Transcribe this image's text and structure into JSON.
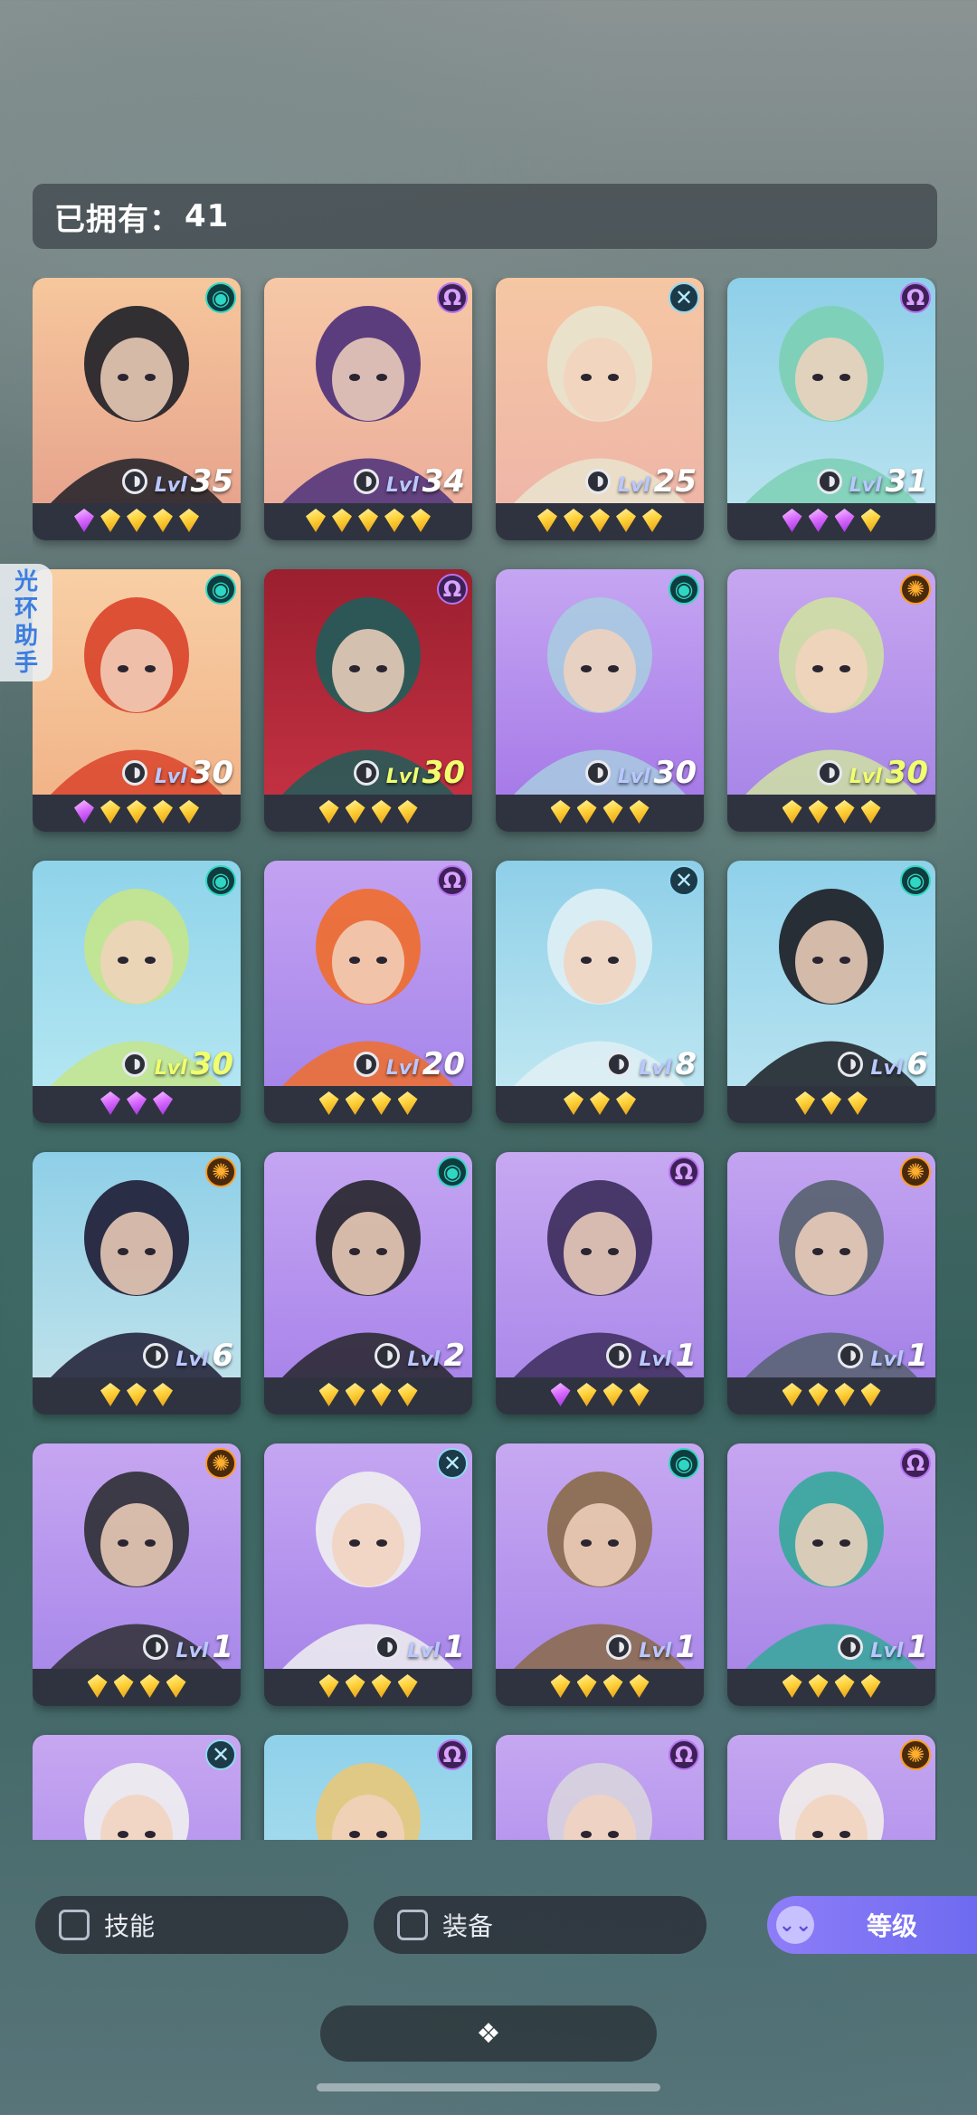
{
  "owned": {
    "label": "已拥有：",
    "count": "41"
  },
  "side_tab": {
    "chars": [
      "光",
      "环",
      "助",
      "手"
    ]
  },
  "level_label": "Lvl",
  "cards": [
    {
      "element": "teal",
      "level": "35",
      "stars": [
        "p",
        "g",
        "g",
        "g",
        "g"
      ],
      "bg": [
        "#f6c79c",
        "#e7a48d"
      ]
    },
    {
      "element": "purple",
      "level": "34",
      "stars": [
        "g",
        "g",
        "g",
        "g",
        "g"
      ],
      "bg": [
        "#f6c8a6",
        "#ecae9b"
      ]
    },
    {
      "element": "cross",
      "level": "25",
      "stars": [
        "g",
        "g",
        "g",
        "g",
        "g"
      ],
      "bg": [
        "#f5c7a3",
        "#efb6a8"
      ]
    },
    {
      "element": "purple",
      "level": "31",
      "stars": [
        "p",
        "p",
        "p",
        "g"
      ],
      "bg": [
        "#8ecfe8",
        "#b7e2ef"
      ]
    },
    {
      "element": "teal",
      "level": "30",
      "stars": [
        "p",
        "g",
        "g",
        "g",
        "g"
      ],
      "bg": [
        "#f8cfa5",
        "#f2b489"
      ]
    },
    {
      "element": "purple",
      "level": "30",
      "stars": [
        "g",
        "g",
        "g",
        "g"
      ],
      "bg": [
        "#9a1f2f",
        "#c23142"
      ],
      "high": true
    },
    {
      "element": "teal",
      "level": "30",
      "stars": [
        "g",
        "g",
        "g",
        "g"
      ],
      "bg": [
        "#c5a6f2",
        "#a77be8"
      ]
    },
    {
      "element": "orange",
      "level": "30",
      "stars": [
        "g",
        "g",
        "g",
        "g"
      ],
      "bg": [
        "#c7a6f0",
        "#a887e8"
      ],
      "high": true
    },
    {
      "element": "teal",
      "level": "30",
      "stars": [
        "p",
        "p",
        "p"
      ],
      "bg": [
        "#8fd3ea",
        "#b3e6f2"
      ],
      "high": true
    },
    {
      "element": "purple",
      "level": "20",
      "stars": [
        "g",
        "g",
        "g",
        "g"
      ],
      "bg": [
        "#c3a2f2",
        "#a686ea"
      ]
    },
    {
      "element": "cross",
      "level": "8",
      "stars": [
        "g",
        "g",
        "g"
      ],
      "bg": [
        "#8ecfe8",
        "#bde6f1"
      ]
    },
    {
      "element": "teal",
      "level": "6",
      "stars": [
        "g",
        "g",
        "g"
      ],
      "bg": [
        "#8fd1ea",
        "#b6e2f0"
      ]
    },
    {
      "element": "orange",
      "level": "6",
      "stars": [
        "g",
        "g",
        "g"
      ],
      "bg": [
        "#8ecfe8",
        "#bde1ea"
      ]
    },
    {
      "element": "teal",
      "level": "2",
      "stars": [
        "g",
        "g",
        "g",
        "g"
      ],
      "bg": [
        "#c4a5f2",
        "#a985ea"
      ]
    },
    {
      "element": "purple",
      "level": "1",
      "stars": [
        "p",
        "g",
        "g",
        "g"
      ],
      "bg": [
        "#c7a8f1",
        "#ab8aea"
      ]
    },
    {
      "element": "orange",
      "level": "1",
      "stars": [
        "g",
        "g",
        "g",
        "g"
      ],
      "bg": [
        "#c3a4f0",
        "#a482e8"
      ]
    },
    {
      "element": "orange",
      "level": "1",
      "stars": [
        "g",
        "g",
        "g",
        "g"
      ],
      "bg": [
        "#c6a6f1",
        "#a989ea"
      ]
    },
    {
      "element": "cross",
      "level": "1",
      "stars": [
        "g",
        "g",
        "g",
        "g"
      ],
      "bg": [
        "#c4a6f2",
        "#a886ea"
      ]
    },
    {
      "element": "teal",
      "level": "1",
      "stars": [
        "g",
        "g",
        "g",
        "g"
      ],
      "bg": [
        "#c7a8f1",
        "#ab8aea"
      ]
    },
    {
      "element": "purple",
      "level": "1",
      "stars": [
        "g",
        "g",
        "g",
        "g"
      ],
      "bg": [
        "#c6a6f0",
        "#a987e8"
      ]
    },
    {
      "element": "cross",
      "level": "",
      "stars": [],
      "bg": [
        "#c7a7f1",
        "#a988ea"
      ]
    },
    {
      "element": "purple",
      "level": "",
      "stars": [],
      "bg": [
        "#8fd1ea",
        "#b4e3f0"
      ]
    },
    {
      "element": "purple",
      "level": "",
      "stars": [],
      "bg": [
        "#c5a7f1",
        "#a886ea"
      ]
    },
    {
      "element": "orange",
      "level": "",
      "stars": [],
      "bg": [
        "#c4a6f0",
        "#a886ea"
      ]
    }
  ],
  "filters": {
    "skill": "技能",
    "equipment": "装备"
  },
  "sort": {
    "label": "等级",
    "icon": "double-chevron-down-icon"
  },
  "expand": {
    "icon": "diamond-cluster-icon",
    "glyph": "❖"
  }
}
